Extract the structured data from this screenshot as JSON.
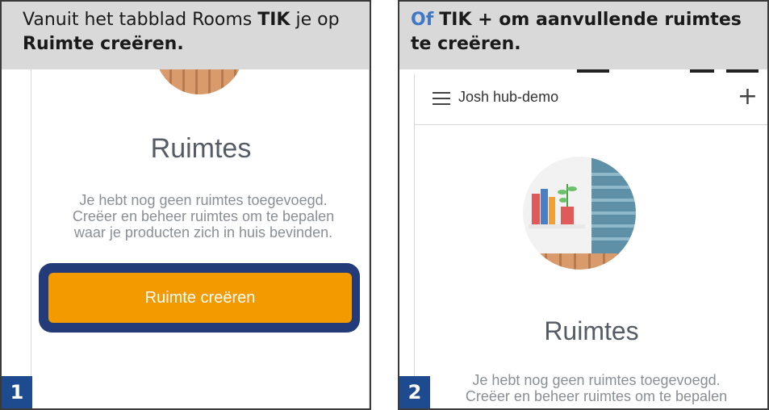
{
  "panel1": {
    "caption_pre": "Vanuit het tabblad Rooms ",
    "caption_bold1": "TIK",
    "caption_mid": " je op",
    "caption_bold2": "Ruimte creëren.",
    "title": "Ruimtes",
    "desc_line1": "Je hebt nog geen ruimtes toegevoegd.",
    "desc_line2": "Creëer en beheer ruimtes om te bepalen",
    "desc_line3": "waar je producten zich in huis bevinden.",
    "button_label": "Ruimte creëren",
    "step": "1"
  },
  "panel2": {
    "caption_accent": "Of",
    "caption_bold": "TIK + om aanvullende ruimtes te creëren.",
    "hub_name": "Josh hub-demo",
    "title": "Ruimtes",
    "desc_line1": "Je hebt nog geen ruimtes toegevoegd.",
    "desc_line2": "Creëer en beheer ruimtes om te bepalen",
    "step": "2"
  },
  "colors": {
    "accent_blue": "#3f78c4",
    "step_badge": "#1e4a8f",
    "button_orange": "#f29a00",
    "button_frame": "#233b78"
  },
  "icons": [
    "hamburger-menu-icon",
    "plus-icon",
    "rooms-illustration"
  ]
}
